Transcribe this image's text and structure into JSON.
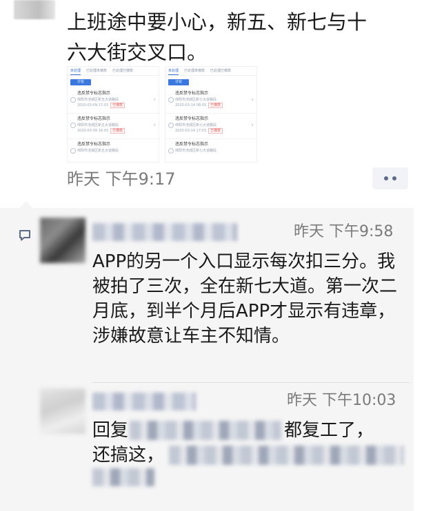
{
  "post": {
    "text_line1": "上班途中要小心，新五、新七与十",
    "text_line2": "六大街交叉口。",
    "time": "昨天 下午9:17",
    "more_icon": "more-dots-icon",
    "thumbnails": [
      {
        "tabs": [
          "未处理",
          "已处理未缴款",
          "已处理已缴款"
        ],
        "button": "讨论",
        "rows": [
          {
            "title": "违反禁令标志指示",
            "place": "绵阳市涪城区新五大道路段",
            "date": "2020-03-09 17:03",
            "tag": "已缴款"
          },
          {
            "title": "违反禁令标志指示",
            "place": "绵阳市涪城区新五大道路段",
            "date": "2020-03-09 16:03",
            "tag": "已缴款"
          },
          {
            "title": "违反禁令标志指示",
            "place": "绵阳市涪城区新五大道路段",
            "date": "",
            "tag": ""
          }
        ]
      },
      {
        "tabs": [
          "未处理",
          "已处理未缴款",
          "已处理已缴款"
        ],
        "button": "讨论",
        "rows": [
          {
            "title": "违反禁令标志指示",
            "place": "绵阳市涪城区新七大道路段",
            "date": "2020-03-14 08:03",
            "tag": "已缴款"
          },
          {
            "title": "违反禁令标志指示",
            "place": "绵阳市涪城区新七大道路段",
            "date": "2020-03-14 17:03",
            "tag": "已缴款"
          },
          {
            "title": "违反禁令标志指示",
            "place": "绵阳市涪城区新七大道路段",
            "date": "",
            "tag": ""
          }
        ]
      }
    ]
  },
  "comments": {
    "comment_icon": "comment-bubble-icon",
    "items": [
      {
        "time": "昨天 下午9:58",
        "text": "APP的另一个入口显示每次扣三分。我被拍了三次，全在新七大道。第一次二月底，到半个月后APP才显示有违章，涉嫌故意让车主不知情。"
      },
      {
        "time": "昨天 下午10:03",
        "line1_prefix": "回复",
        "line1_suffix": "都复工了，",
        "line2_prefix": "还搞这，"
      }
    ]
  },
  "colors": {
    "panel_bg": "#f5f5f5",
    "accent": "#5d6a87",
    "time_text": "#7a7a7a"
  }
}
